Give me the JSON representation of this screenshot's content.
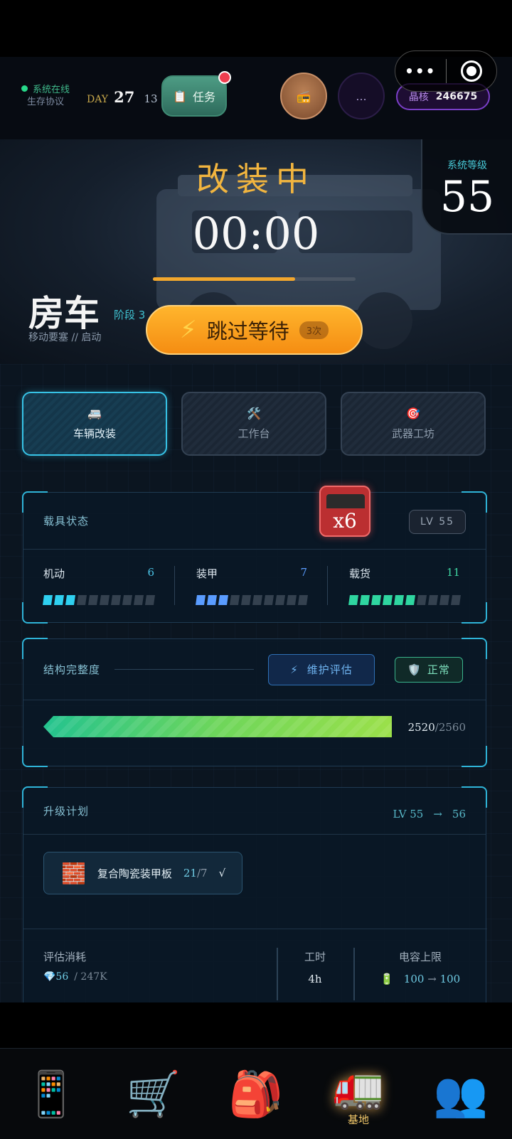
{
  "status": {
    "online": "系统在线",
    "protocol": "生存协议"
  },
  "day": {
    "label": "DAY",
    "number": "27",
    "time": "13"
  },
  "task": {
    "label": "任务",
    "icon": "clipboard-icon"
  },
  "radio": {
    "icon": "radio-icon",
    "glyph": "📻"
  },
  "more": {
    "label": "..."
  },
  "crystal": {
    "label": "晶核",
    "value": "246675"
  },
  "capsule": {
    "dots": "•••"
  },
  "hero": {
    "title": "改装中",
    "timer": "00:00",
    "progress": 0.7,
    "level_label": "系统等级",
    "level_value": "55",
    "vehicle_name": "房车",
    "stage": "阶段 3",
    "subtitle": "移动要塞 // 启动"
  },
  "skip": {
    "label": "跳过等待",
    "count": "3次",
    "icon": "lightning-icon"
  },
  "tabs": [
    {
      "label": "车辆改装",
      "icon": "🚐",
      "active": true
    },
    {
      "label": "工作台",
      "icon": "🛠️",
      "active": false
    },
    {
      "label": "武器工坊",
      "icon": "🎯",
      "active": false
    }
  ],
  "vehicle_status": {
    "title": "载具状态",
    "level": "LV 55",
    "multiplier": "x6",
    "stats": [
      {
        "name": "机动",
        "value": "6",
        "filled": 3,
        "total": 10,
        "color": "#2fd0f0",
        "value_color": "#4cc5e8"
      },
      {
        "name": "装甲",
        "value": "7",
        "filled": 3,
        "total": 10,
        "color": "#5a9cff",
        "value_color": "#5a9cff"
      },
      {
        "name": "载货",
        "value": "11",
        "filled": 6,
        "total": 10,
        "color": "#2fd6a0",
        "value_color": "#3fd6a2"
      }
    ]
  },
  "integrity": {
    "title": "结构完整度",
    "maintain_label": "维护评估",
    "status_label": "正常",
    "current": "2520",
    "max": "/2560",
    "ratio": 0.984
  },
  "upgrade": {
    "title": "升级计划",
    "from": "LV 55",
    "arrow": "→",
    "to": "56",
    "material": {
      "name": "复合陶瓷装甲板",
      "have": "21",
      "need": "/7",
      "check": "√",
      "icon": "🧱"
    },
    "cost_label": "评估消耗",
    "cost_value": "💎56",
    "cost_total": "/ 247K",
    "time_label": "工时",
    "time_value": "4h",
    "power_label": "电容上限",
    "power_from": "100",
    "power_to": "100",
    "power_arrow": "→",
    "power_icon": "🔋"
  },
  "nav": [
    {
      "icon": "📱",
      "label": ""
    },
    {
      "icon": "🛒",
      "label": ""
    },
    {
      "icon": "🎒",
      "label": ""
    },
    {
      "icon": "🚛",
      "label": "基地",
      "active": true
    },
    {
      "icon": "👥",
      "label": ""
    }
  ]
}
